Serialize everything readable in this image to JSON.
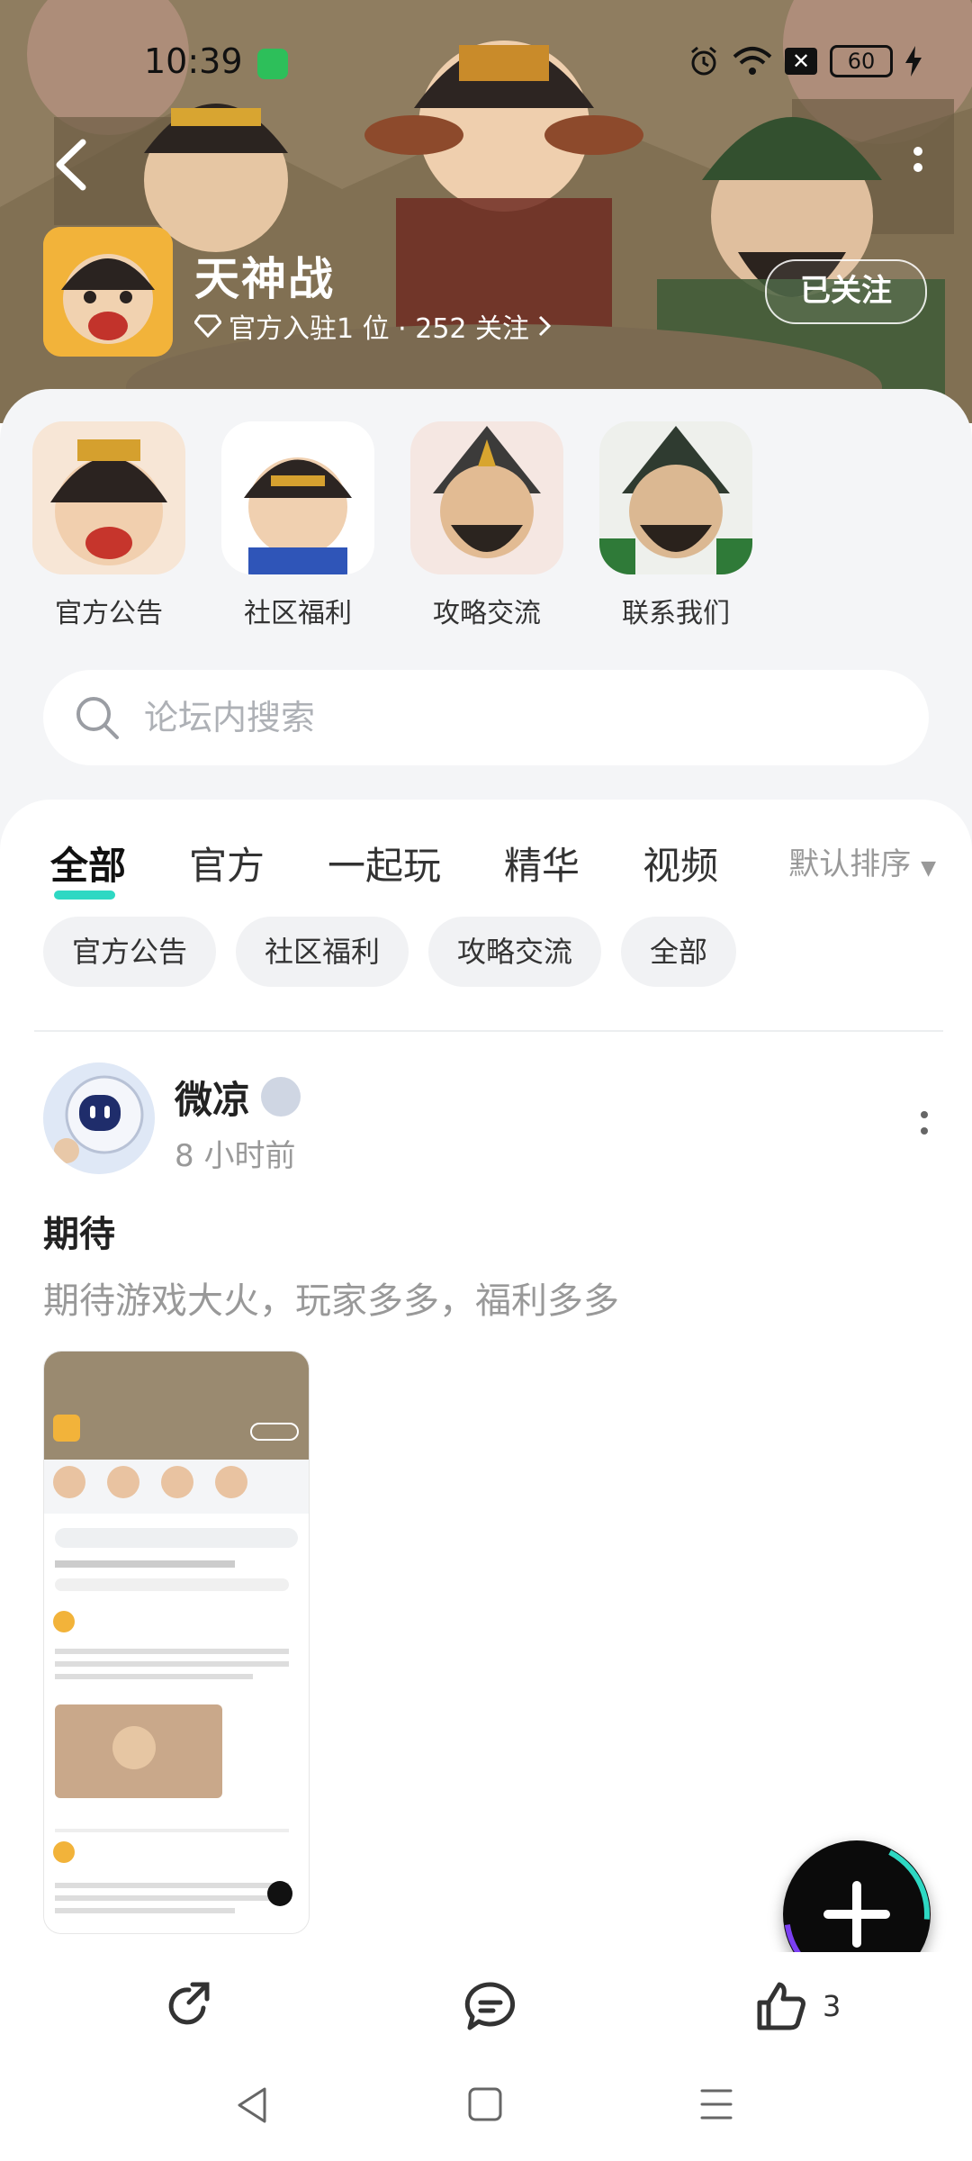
{
  "status_bar": {
    "time": "10:39",
    "battery": "60"
  },
  "header": {
    "game_name": "天神战",
    "meta": "官方入驻1 位 · 252 关注",
    "follow_label": "已关注"
  },
  "shortcuts": [
    {
      "label": "官方公告"
    },
    {
      "label": "社区福利"
    },
    {
      "label": "攻略交流"
    },
    {
      "label": "联系我们"
    }
  ],
  "search": {
    "placeholder": "论坛内搜索"
  },
  "tabs": [
    "全部",
    "官方",
    "一起玩",
    "精华",
    "视频"
  ],
  "sort_label": "默认排序",
  "chips": [
    "官方公告",
    "社区福利",
    "攻略交流",
    "全部"
  ],
  "post": {
    "author": "微凉",
    "time": "8 小时前",
    "title": "期待",
    "body": "期待游戏大火，玩家多多，福利多多"
  },
  "actions": {
    "like_count": "3"
  },
  "colors": {
    "accent": "#2ed8c3",
    "follow_border": "#ffffff",
    "muted_text": "#999999"
  }
}
